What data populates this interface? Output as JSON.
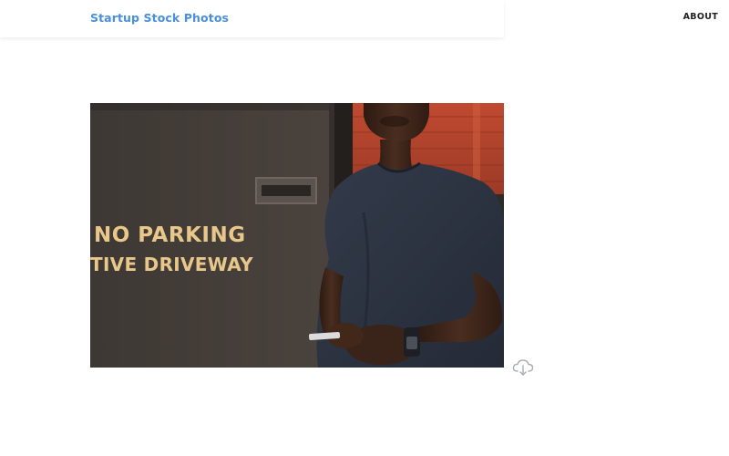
{
  "header": {
    "logo_text": "Startup Stock Photos",
    "nav": {
      "about_label": "ABOUT"
    }
  },
  "photo": {
    "sign_line_1": "NO PARKING",
    "sign_line_2": "TIVE DRIVEWAY"
  },
  "icons": {
    "download": "cloud-download-icon"
  },
  "colors": {
    "logo": "#4a90d9",
    "nav_text": "#222222",
    "wall": "#403a36",
    "brick": "#b5432c",
    "shirt": "#2b3240",
    "skin": "#3b2418",
    "sign_text": "#e8c88a"
  }
}
